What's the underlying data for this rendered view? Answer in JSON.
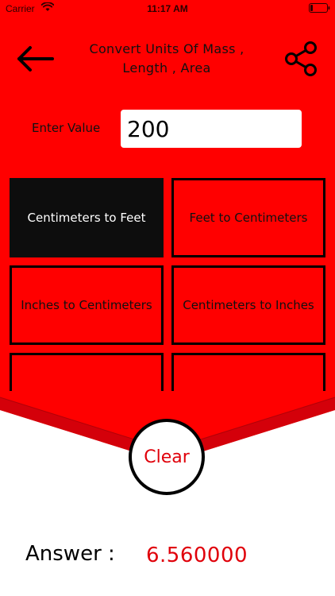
{
  "status_bar": {
    "carrier": "Carrier",
    "time": "11:17 AM",
    "wifi_icon": "wifi-icon",
    "battery_icon": "battery-icon"
  },
  "header": {
    "back_icon": "arrow-left-icon",
    "title_line1": "Convert Units Of Mass ,",
    "title_line2": "Length , Area",
    "share_icon": "share-icon"
  },
  "input": {
    "label": "Enter Value",
    "value": "200",
    "placeholder": ""
  },
  "conversions": [
    {
      "label": "Centimeters to Feet",
      "active": true
    },
    {
      "label": "Feet to Centimeters",
      "active": false
    },
    {
      "label": "Inches to Centimeters",
      "active": false
    },
    {
      "label": "Centimeters to Inches",
      "active": false
    }
  ],
  "clear_button": {
    "label": "Clear"
  },
  "answer": {
    "label": "Answer :",
    "value": "6.560000"
  },
  "colors": {
    "accent_red": "#ff0000",
    "dark_red": "#d4000a",
    "active_tile": "#0d0d0d",
    "answer_text": "#e0000a",
    "background": "#ffffff"
  }
}
